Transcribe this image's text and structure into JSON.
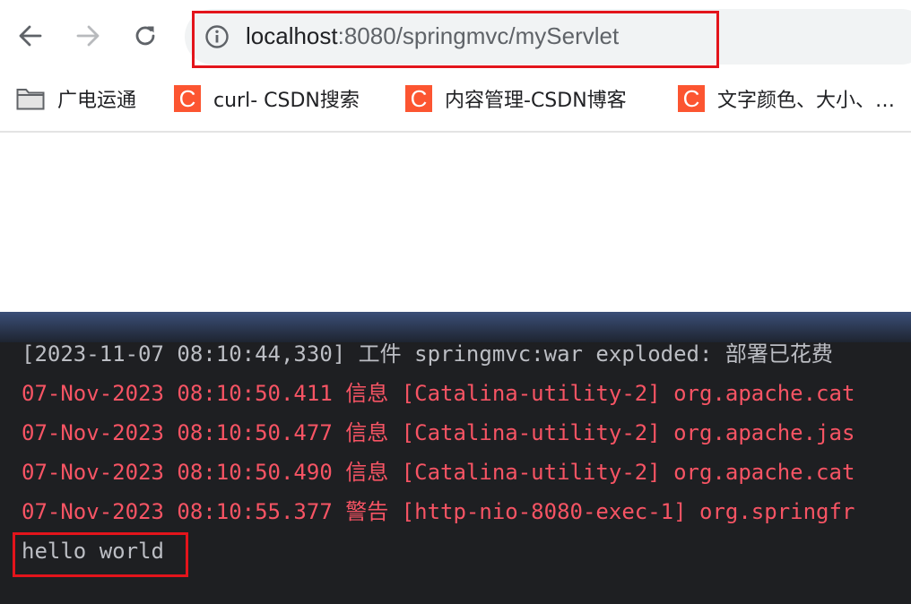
{
  "toolbar": {
    "back_icon": "arrow-left-icon",
    "forward_icon": "arrow-right-icon",
    "reload_icon": "reload-icon"
  },
  "address_bar": {
    "host": "localhost",
    "rest": ":8080/springmvc/myServlet",
    "info_icon": "info-icon",
    "highlight_color": "#e3141b"
  },
  "bookmarks": [
    {
      "label": "广电运通",
      "icon": "folder-icon"
    },
    {
      "label": "curl- CSDN搜索",
      "icon": "csdn-icon",
      "icon_char": "C"
    },
    {
      "label": "内容管理-CSDN博客",
      "icon": "csdn-icon",
      "icon_char": "C"
    },
    {
      "label": "文字颜色、大小、…",
      "icon": "csdn-icon",
      "icon_char": "C"
    }
  ],
  "console": {
    "lines": [
      {
        "text": "[2023-11-07 08:10:44,330] 工件 springmvc:war exploded: 部署已花费",
        "color": "#bcbec4"
      },
      {
        "text": "07-Nov-2023 08:10:50.411 信息 [Catalina-utility-2] org.apache.cat",
        "color": "#f75464"
      },
      {
        "text": "07-Nov-2023 08:10:50.477 信息 [Catalina-utility-2] org.apache.jas",
        "color": "#f75464"
      },
      {
        "text": "07-Nov-2023 08:10:50.490 信息 [Catalina-utility-2] org.apache.cat",
        "color": "#f75464"
      },
      {
        "text": "07-Nov-2023 08:10:55.377 警告 [http-nio-8080-exec-1] org.springfr",
        "color": "#f75464"
      },
      {
        "text": "hello world",
        "color": "#bcbec4"
      }
    ]
  }
}
